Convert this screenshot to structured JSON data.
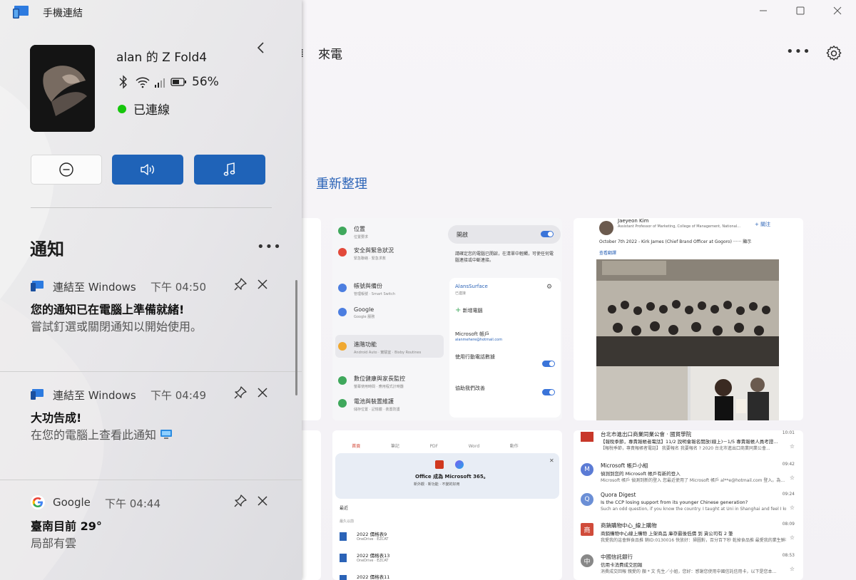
{
  "app": {
    "title": "手機連結"
  },
  "device": {
    "name": "alan 的 Z Fold4",
    "battery": "56%",
    "connection": "已連線"
  },
  "main": {
    "section_title": "來電",
    "refresh_label": "重新整理"
  },
  "notifications": {
    "title": "通知",
    "items": [
      {
        "app": "連結至 Windows",
        "time": "下午 04:50",
        "title": "您的通知已在電腦上準備就緒!",
        "body": "嘗試釘選或關閉通知以開始使用。"
      },
      {
        "app": "連結至 Windows",
        "time": "下午 04:49",
        "title": "大功告成!",
        "body": "在您的電腦上查看此通知"
      },
      {
        "app": "Google",
        "time": "下午 04:44",
        "title": "臺南目前 29°",
        "body": "局部有雲"
      }
    ]
  },
  "settings_card": {
    "items": [
      {
        "title": "位置",
        "sub": "位置要求"
      },
      {
        "title": "安全與緊急狀況",
        "sub": "緊急聯絡 · 緊急求救"
      },
      {
        "title": "帳號與備份",
        "sub": "管理帳號 · Smart Switch"
      },
      {
        "title": "Google",
        "sub": "Google 服務"
      },
      {
        "title": "進階功能",
        "sub": "Android Auto · 實驗室 · Bixby Routines"
      },
      {
        "title": "數位健康與家長監控",
        "sub": "螢幕使用時間 · 應用程式計時器"
      },
      {
        "title": "電池與裝置維護",
        "sub": "儲存位置 · 記憶體 · 裝置防護"
      }
    ],
    "toggle_label": "開啟",
    "desc": "請確定您的電腦已開啟，在清單中輕觸，可使任何電腦連接或中斷連接。",
    "device_label": "AlansSurface",
    "device_sub": "已連接",
    "add_pc": "新增電腦",
    "account_label": "Microsoft 帳戶",
    "account_sub": "alanmehere@hotmail.com",
    "mobile_data": "使用行動電話數據",
    "improve": "協助我們改善"
  },
  "office_card": {
    "banner": "Office 成為 Microsoft 365。",
    "banner_sub": "新外觀 · 新功能 · 不變的好用",
    "recent": "最近",
    "files": [
      {
        "name": "2022 價格表9",
        "loc": "OneDrive · EZCAT"
      },
      {
        "name": "2022 價格表13",
        "loc": "OneDrive · EZCAT"
      },
      {
        "name": "2022 價格表11",
        "loc": ""
      }
    ],
    "tabs": [
      "首頁",
      "筆記",
      "PDF",
      "Word",
      "動作"
    ]
  },
  "photo_card": {
    "author": "Jaeyeon Kim",
    "role": "Assistant Professor of Marketing, College of Management, National...",
    "follow": "+ 關注",
    "post": "October 7th 2022 - Kirk James (Chief Brand Officer at Gogoro) ······ 顯示",
    "translate": "查看翻譯"
  },
  "mail_card": {
    "rows": [
      {
        "from": "Microsoft 帳戶小組",
        "time": "09:42",
        "subj": "偵測到您的 Microsoft 帳戶有新的登入",
        "prev": "Microsoft 帳戶 偵測到新的登入 您最近使用了 Microsoft 帳戶 al**e@hotmail.com 登入。為...",
        "av": "M",
        "color": "#5b7bd5"
      },
      {
        "from": "Quora Digest",
        "time": "09:24",
        "subj": "Is the CCP losing support from its younger Chinese generation?",
        "prev": "Such an odd question, if you know the country. I taught at Uni in Shanghai and feel I kno...",
        "av": "Q",
        "color": "#6b8fd6"
      },
      {
        "from": "商銷購物中心_線上購物",
        "time": "08:09",
        "subj": "商銷購物中心線上購物 上架商品 庫存最後低價 到 貨公司有 2 筆",
        "prev": "我愛我的這會鮮食品推 銷ID:0130016 快放好：掃圖對，百分百下秒 乾掉食品推 最愛我的業生鮮市...",
        "av": "商",
        "color": "#d04b3a"
      },
      {
        "from": "中國信託銀行",
        "time": "08:53",
        "subj": "信用卡消費成交回報",
        "prev": "消費成交回報 親愛的 顏 * 文 先生／小姐，您好：感謝您使用中國信託信用卡，以下是您本...",
        "av": "中",
        "color": "#888888"
      }
    ],
    "top_subj": "【報稅季節，專責報帳者電話】11/2 說明會報名開放(線上)－1/5 專責報帳人員考證...",
    "top_prev": "【報稅季節，專責報帳者電話】 我要報名 我要報名 ? 2020 台北市進出口商業同業公會...",
    "top_from": "台北市進出口商業同業公會 · 國貿學院",
    "top_time": "10:01"
  }
}
